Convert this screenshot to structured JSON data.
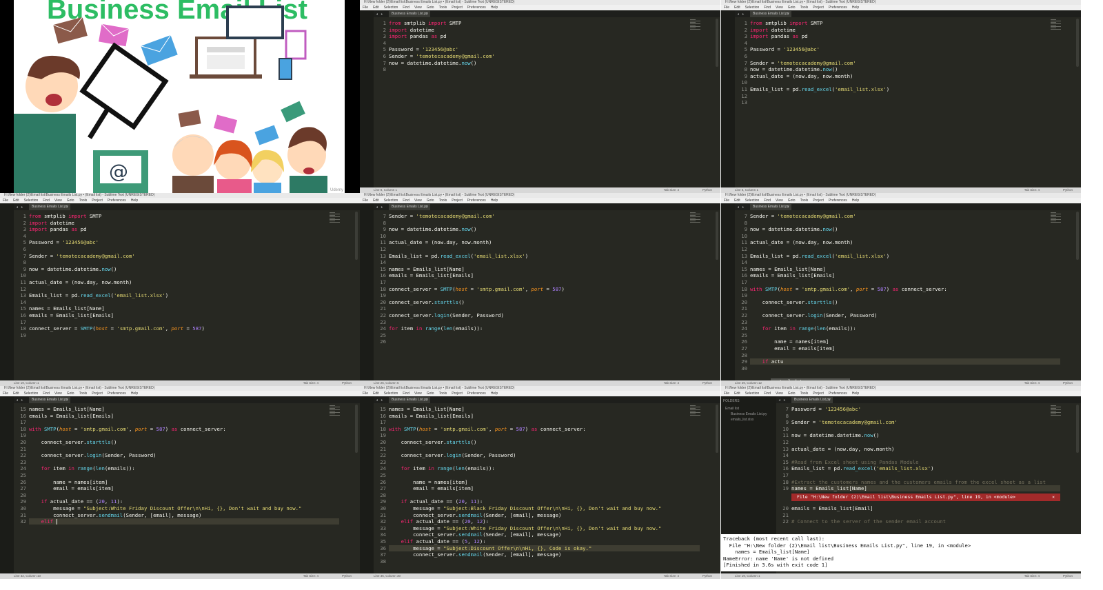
{
  "thumbnail": {
    "title": "Business Email List",
    "watermark": "Udemy",
    "at_symbol": "@"
  },
  "window": {
    "title": "H:\\New folder (2)\\Email list\\Business Emails List.py • (Email list) - Sublime Text (UNREGISTERED)",
    "menu": [
      "File",
      "Edit",
      "Selection",
      "Find",
      "View",
      "Goto",
      "Tools",
      "Project",
      "Preferences",
      "Help"
    ],
    "tab_label": "Business Emails List.py",
    "tab_close": "×",
    "folders_label": "FOLDERS",
    "folder_name": "Email list",
    "folder_files": [
      "Business Emails List.py",
      "emails_list.xlsx"
    ],
    "status_right": "Python",
    "status_tab": "Tab Size: 4"
  },
  "panes": [
    {
      "status": "Line 8, Column 1",
      "lines": [
        {
          "n": "1",
          "h": "<span class='kw'>from</span> smtplib <span class='kw'>import</span> SMTP"
        },
        {
          "n": "2",
          "h": "<span class='kw'>import</span> datetime"
        },
        {
          "n": "3",
          "h": "<span class='kw'>import</span> pandas <span class='kw'>as</span> pd"
        },
        {
          "n": "4",
          "h": ""
        },
        {
          "n": "5",
          "h": "Password = <span class='st'>'123456@abc'</span>"
        },
        {
          "n": "6",
          "h": "Sender = <span class='st'>'temotecacademy@gmail.com'</span>"
        },
        {
          "n": "7",
          "h": "now = datetime.datetime.<span class='fn'>now</span>()"
        },
        {
          "n": "8",
          "h": "",
          "hl": true
        }
      ]
    },
    {
      "status": "Line 6, Column 1",
      "lines": [
        {
          "n": "1",
          "h": "<span class='kw'>from</span> smtplib <span class='kw'>import</span> SMTP"
        },
        {
          "n": "2",
          "h": "<span class='kw'>import</span> datetime"
        },
        {
          "n": "3",
          "h": "<span class='kw'>import</span> pandas <span class='kw'>as</span> pd"
        },
        {
          "n": "4",
          "h": ""
        },
        {
          "n": "5",
          "h": "Password = <span class='st'>'123456@abc'</span>"
        },
        {
          "n": "6",
          "h": "",
          "hl": true
        },
        {
          "n": "7",
          "h": "Sender = <span class='st'>'temotecacademy@gmail.com'</span>"
        },
        {
          "n": "8",
          "h": "now = datetime.datetime.<span class='fn'>now</span>()"
        },
        {
          "n": "9",
          "h": "actual_date = (now.day, now.month)"
        },
        {
          "n": "10",
          "h": ""
        },
        {
          "n": "11",
          "h": "Emails_list = pd.<span class='fn'>read_excel</span>(<span class='st'>'email_list.xlsx'</span>)"
        },
        {
          "n": "12",
          "h": ""
        },
        {
          "n": "13",
          "h": ""
        }
      ]
    },
    {
      "status": "Line 19, Column 1",
      "lines": [
        {
          "n": "1",
          "h": "<span class='kw'>from</span> smtplib <span class='kw'>import</span> SMTP"
        },
        {
          "n": "2",
          "h": "<span class='kw'>import</span> datetime"
        },
        {
          "n": "3",
          "h": "<span class='kw'>import</span> pandas <span class='kw'>as</span> pd"
        },
        {
          "n": "4",
          "h": ""
        },
        {
          "n": "5",
          "h": "Password = <span class='st'>'123456@abc'</span>"
        },
        {
          "n": "6",
          "h": ""
        },
        {
          "n": "7",
          "h": "Sender = <span class='st'>'temotecacademy@gmail.com'</span>"
        },
        {
          "n": "8",
          "h": ""
        },
        {
          "n": "9",
          "h": "now = datetime.datetime.<span class='fn'>now</span>()"
        },
        {
          "n": "10",
          "h": ""
        },
        {
          "n": "11",
          "h": "actual_date = (now.day, now.month)"
        },
        {
          "n": "12",
          "h": ""
        },
        {
          "n": "13",
          "h": "Emails_list = pd.<span class='fn'>read_excel</span>(<span class='st'>'email_list.xlsx'</span>)"
        },
        {
          "n": "14",
          "h": ""
        },
        {
          "n": "15",
          "h": "names = Emails_list[Name]"
        },
        {
          "n": "16",
          "h": "emails = Emails_list[Emails]"
        },
        {
          "n": "17",
          "h": ""
        },
        {
          "n": "18",
          "h": "connect_server = <span class='fn'>SMTP</span>(<span class='pa'>host</span> = <span class='st'>'smtp.gmail.com'</span>, <span class='pa'>port</span> = <span class='nm'>587</span>)"
        },
        {
          "n": "19",
          "h": "",
          "hl": true
        }
      ]
    },
    {
      "status": "Line 26, Column 5",
      "lines": [
        {
          "n": "7",
          "h": "Sender = <span class='st'>'temotecacademy@gmail.com'</span>"
        },
        {
          "n": "8",
          "h": ""
        },
        {
          "n": "9",
          "h": "now = datetime.datetime.<span class='fn'>now</span>()"
        },
        {
          "n": "10",
          "h": ""
        },
        {
          "n": "11",
          "h": "actual_date = (now.day, now.month)"
        },
        {
          "n": "12",
          "h": ""
        },
        {
          "n": "13",
          "h": "Emails_list = pd.<span class='fn'>read_excel</span>(<span class='st'>'email_list.xlsx'</span>)"
        },
        {
          "n": "14",
          "h": ""
        },
        {
          "n": "15",
          "h": "names = Emails_list[Name]"
        },
        {
          "n": "16",
          "h": "emails = Emails_list[Emails]"
        },
        {
          "n": "17",
          "h": ""
        },
        {
          "n": "18",
          "h": "connect_server = <span class='fn'>SMTP</span>(<span class='pa'>host</span> = <span class='st'>'smtp.gmail.com'</span>, <span class='pa'>port</span> = <span class='nm'>587</span>)"
        },
        {
          "n": "19",
          "h": ""
        },
        {
          "n": "20",
          "h": "connect_server.<span class='fn'>starttls</span>()"
        },
        {
          "n": "21",
          "h": ""
        },
        {
          "n": "22",
          "h": "connect_server.<span class='fn'>login</span>(Sender, Password)"
        },
        {
          "n": "23",
          "h": ""
        },
        {
          "n": "24",
          "h": "<span class='kw'>for</span> item <span class='kw'>in</span> <span class='fn'>range</span>(<span class='fn'>len</span>(emails)):"
        },
        {
          "n": "25",
          "h": ""
        },
        {
          "n": "26",
          "h": "",
          "hl": true
        }
      ]
    },
    {
      "status": "Line 29, Column 12",
      "lines": [
        {
          "n": "7",
          "h": "Sender = <span class='st'>'temotecacademy@gmail.com'</span>"
        },
        {
          "n": "8",
          "h": ""
        },
        {
          "n": "9",
          "h": "now = datetime.datetime.<span class='fn'>now</span>()"
        },
        {
          "n": "10",
          "h": ""
        },
        {
          "n": "11",
          "h": "actual_date = (now.day, now.month)"
        },
        {
          "n": "12",
          "h": ""
        },
        {
          "n": "13",
          "h": "Emails_list = pd.<span class='fn'>read_excel</span>(<span class='st'>'email_list.xlsx'</span>)"
        },
        {
          "n": "14",
          "h": ""
        },
        {
          "n": "15",
          "h": "names = Emails_list[Name]"
        },
        {
          "n": "16",
          "h": "emails = Emails_list[Emails]"
        },
        {
          "n": "17",
          "h": ""
        },
        {
          "n": "18",
          "h": "<span class='kw'>with</span> <span class='fn'>SMTP</span>(<span class='pa'>host</span> = <span class='st'>'smtp.gmail.com'</span>, <span class='pa'>port</span> = <span class='nm'>587</span>) <span class='kw'>as</span> connect_server:"
        },
        {
          "n": "19",
          "h": ""
        },
        {
          "n": "20",
          "h": "    connect_server.<span class='fn'>starttls</span>()"
        },
        {
          "n": "21",
          "h": ""
        },
        {
          "n": "22",
          "h": "    connect_server.<span class='fn'>login</span>(Sender, Password)"
        },
        {
          "n": "23",
          "h": ""
        },
        {
          "n": "24",
          "h": "    <span class='kw'>for</span> item <span class='kw'>in</span> <span class='fn'>range</span>(<span class='fn'>len</span>(emails)):"
        },
        {
          "n": "25",
          "h": ""
        },
        {
          "n": "26",
          "h": "        name = names[item]"
        },
        {
          "n": "27",
          "h": "        email = emails[item]"
        },
        {
          "n": "28",
          "h": ""
        },
        {
          "n": "29",
          "h": "    <span class='kw'>if</span> actu",
          "hl": true
        },
        {
          "n": "30",
          "h": ""
        }
      ],
      "autocomplete": "actual_date"
    },
    {
      "status": "Line 32, Column 10",
      "lines": [
        {
          "n": "15",
          "h": "names = Emails_list[Name]"
        },
        {
          "n": "16",
          "h": "emails = Emails_list[Emails]"
        },
        {
          "n": "17",
          "h": ""
        },
        {
          "n": "18",
          "h": "<span class='kw'>with</span> <span class='fn'>SMTP</span>(<span class='pa'>host</span> = <span class='st'>'smtp.gmail.com'</span>, <span class='pa'>port</span> = <span class='nm'>587</span>) <span class='kw'>as</span> connect_server:"
        },
        {
          "n": "19",
          "h": ""
        },
        {
          "n": "20",
          "h": "    connect_server.<span class='fn'>starttls</span>()"
        },
        {
          "n": "21",
          "h": ""
        },
        {
          "n": "22",
          "h": "    connect_server.<span class='fn'>login</span>(Sender, Password)"
        },
        {
          "n": "23",
          "h": ""
        },
        {
          "n": "24",
          "h": "    <span class='kw'>for</span> item <span class='kw'>in</span> <span class='fn'>range</span>(<span class='fn'>len</span>(emails)):"
        },
        {
          "n": "25",
          "h": ""
        },
        {
          "n": "26",
          "h": "        name = names[item]"
        },
        {
          "n": "27",
          "h": "        email = emails[item]"
        },
        {
          "n": "28",
          "h": ""
        },
        {
          "n": "29",
          "h": "    <span class='kw'>if</span> actual_date == (<span class='nm'>20</span>, <span class='nm'>11</span>):"
        },
        {
          "n": "30",
          "h": "        message = <span class='st'>\"Subject:White Friday Discount Offer\\n\\nHi, {}, Don't wait and buy now.\"</span>"
        },
        {
          "n": "31",
          "h": "        connect_server.<span class='fn'>sendmail</span>(Sender, [email], message)"
        },
        {
          "n": "32",
          "h": "    <span class='kw'>elif</span> <span class='cur'></span>",
          "hl": true
        }
      ]
    },
    {
      "status": "Line 36, Column 30",
      "lines": [
        {
          "n": "15",
          "h": "names = Emails_list[Name]"
        },
        {
          "n": "16",
          "h": "emails = Emails_list[Emails]"
        },
        {
          "n": "17",
          "h": ""
        },
        {
          "n": "18",
          "h": "<span class='kw'>with</span> <span class='fn'>SMTP</span>(<span class='pa'>host</span> = <span class='st'>'smtp.gmail.com'</span>, <span class='pa'>port</span> = <span class='nm'>587</span>) <span class='kw'>as</span> connect_server:"
        },
        {
          "n": "19",
          "h": ""
        },
        {
          "n": "20",
          "h": "    connect_server.<span class='fn'>starttls</span>()"
        },
        {
          "n": "21",
          "h": ""
        },
        {
          "n": "22",
          "h": "    connect_server.<span class='fn'>login</span>(Sender, Password)"
        },
        {
          "n": "23",
          "h": ""
        },
        {
          "n": "24",
          "h": "    <span class='kw'>for</span> item <span class='kw'>in</span> <span class='fn'>range</span>(<span class='fn'>len</span>(emails)):"
        },
        {
          "n": "25",
          "h": ""
        },
        {
          "n": "26",
          "h": "        name = names[item]"
        },
        {
          "n": "27",
          "h": "        email = emails[item]"
        },
        {
          "n": "28",
          "h": ""
        },
        {
          "n": "29",
          "h": "    <span class='kw'>if</span> actual_date == (<span class='nm'>20</span>, <span class='nm'>11</span>):"
        },
        {
          "n": "30",
          "h": "        message = <span class='st'>\"Subject:Black Friday Discount Offer\\n\\nHi, {}, Don't wait and buy now.\"</span>"
        },
        {
          "n": "31",
          "h": "        connect_server.<span class='fn'>sendmail</span>(Sender, [email], message)"
        },
        {
          "n": "32",
          "h": "    <span class='kw'>elif</span> actual_date == (<span class='nm'>20</span>, <span class='nm'>12</span>):"
        },
        {
          "n": "33",
          "h": "        message = <span class='st'>\"Subject:White Friday Discount Offer\\n\\nHi, {}, Don't wait and buy now.\"</span>"
        },
        {
          "n": "34",
          "h": "        connect_server.<span class='fn'>sendmail</span>(Sender, [email], message)"
        },
        {
          "n": "35",
          "h": "    <span class='kw'>elif</span> actual_date == (<span class='nm'>5</span>, <span class='nm'>12</span>):"
        },
        {
          "n": "36",
          "h": "        message = <span class='st'>\"Subject:Discount Offer\\n\\nHi, {}, Code is okay.\"</span>",
          "hl": true
        },
        {
          "n": "37",
          "h": "        connect_server.<span class='fn'>sendmail</span>(Sender, [email], message)"
        },
        {
          "n": "38",
          "h": ""
        }
      ]
    },
    {
      "status": "Line 19, Column 1",
      "lines": [
        {
          "n": "7",
          "h": "Password = <span class='st'>'123456@abc'</span>"
        },
        {
          "n": "8",
          "h": ""
        },
        {
          "n": "9",
          "h": "Sender = <span class='st'>'temotecacademy@gmail.com'</span>"
        },
        {
          "n": "10",
          "h": ""
        },
        {
          "n": "11",
          "h": "now = datetime.datetime.<span class='fn'>now</span>()"
        },
        {
          "n": "12",
          "h": ""
        },
        {
          "n": "13",
          "h": "actual_date = (now.day, now.month)"
        },
        {
          "n": "14",
          "h": ""
        },
        {
          "n": "15",
          "h": "<span class='cm'>#Read from Excel sheet using Pandas Module</span>"
        },
        {
          "n": "16",
          "h": "Emails_list = pd.<span class='fn'>read_excel</span>(<span class='st'>'emails_list.xlsx'</span>)"
        },
        {
          "n": "17",
          "h": ""
        },
        {
          "n": "18",
          "h": "<span class='cm'>#Extract the customers names and the customers emails from the excel sheet as a list</span>"
        },
        {
          "n": "19",
          "h": "names = Emails_list[Name]",
          "hl": true
        },
        {
          "n": "",
          "h": ""
        },
        {
          "n": "",
          "h": ""
        },
        {
          "n": "20",
          "h": "emails = Emails_list[Email]"
        },
        {
          "n": "21",
          "h": ""
        },
        {
          "n": "22",
          "h": "<span class='cm'># Connect to the server of the sender email account</span>"
        }
      ],
      "error_inline": "File \"H:\\New folder (2)\\Email list\\Business Emails List.py\", line 19, in <module>",
      "error_close": "×",
      "console": "Traceback (most recent call last):\n  File \"H:\\New folder (2)\\Email list\\Business Emails List.py\", line 19, in <module>\n    names = Emails_list[Name]\nNameError: name 'Name' is not defined\n[Finished in 3.6s with exit code 1]"
    }
  ]
}
